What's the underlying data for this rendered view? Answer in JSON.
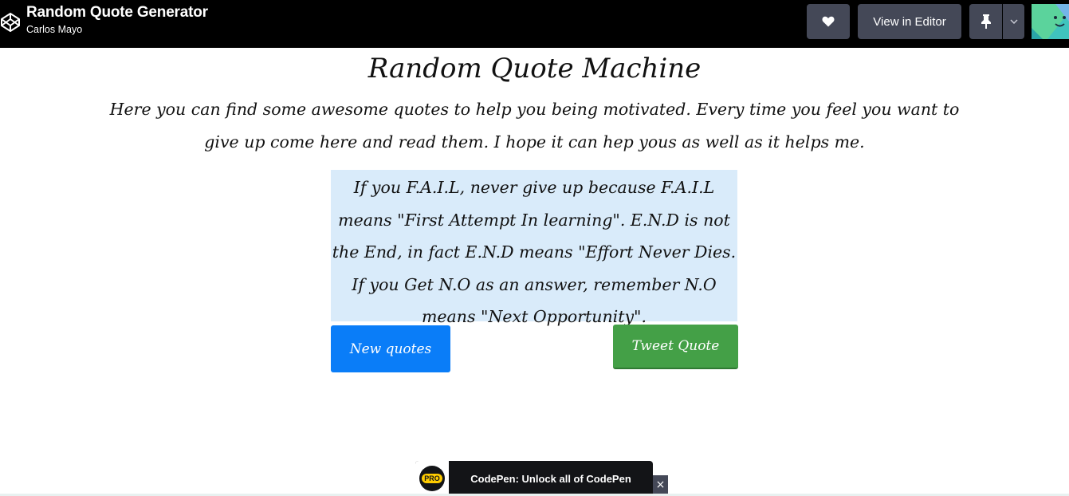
{
  "header": {
    "pen_title": "Random Quote Generator",
    "author": "Carlos Mayo",
    "view_in_editor_label": "View in Editor",
    "icons": {
      "logo": "codepen-logo-icon",
      "heart": "heart-icon",
      "pin": "pin-icon",
      "chevron": "chevron-down-icon",
      "avatar": "user-avatar"
    }
  },
  "page": {
    "title": "Random Quote Machine",
    "intro": "Here you can find some awesome quotes to help you being motivated. Every time you feel you want to give up come here and read them. I hope it can hep yous as well as it helps me.",
    "quote": "If you F.A.I.L, never give up because F.A.I.L means \"First Attempt In learning\". E.N.D is not the End, in fact E.N.D means \"Effort Never Dies. If you Get N.O as an answer, remember N.O means \"Next Opportunity\".",
    "new_quote_label": "New quotes",
    "tweet_label": "Tweet Quote"
  },
  "promo": {
    "badge": "PRO",
    "text": "CodePen: Unlock all of CodePen",
    "close": "×"
  },
  "colors": {
    "topbar": "#000000",
    "button_dark": "#444857",
    "quote_bg": "#d9ebfa",
    "new_quote_btn": "#0a7df8",
    "tweet_btn": "#44a047",
    "pro_yellow": "#ffcc00"
  }
}
